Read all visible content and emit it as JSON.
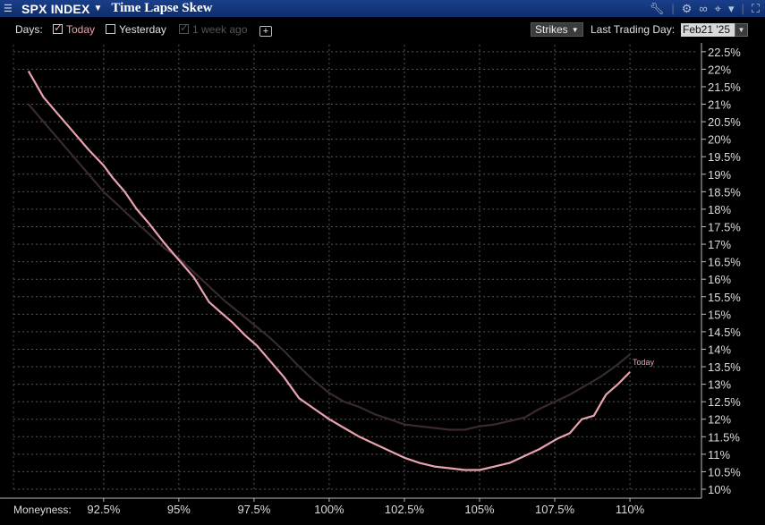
{
  "window": {
    "ticker": "SPX INDEX",
    "title": "Time Lapse Skew"
  },
  "toolbar": {
    "days_label": "Days:",
    "today_label": "Today",
    "yesterday_label": "Yesterday",
    "week_label": "1 week ago",
    "today_checked": true,
    "yesterday_checked": false,
    "week_checked": true,
    "add_label": "+",
    "mode_value": "Strikes",
    "last_trading_label": "Last Trading Day:",
    "last_trading_value": "Feb21 '25"
  },
  "colors": {
    "today": "#e8a3ae",
    "week": "#3a2a2e",
    "grid": "#555555",
    "background": "#000000"
  },
  "chart_data": {
    "type": "line",
    "xlabel": "Moneyness:",
    "ylabel": "",
    "xlim": [
      89.5,
      112.2
    ],
    "ylim": [
      10,
      22.7
    ],
    "x_ticks": [
      "92.5%",
      "95%",
      "97.5%",
      "100%",
      "102.5%",
      "105%",
      "107.5%",
      "110%"
    ],
    "x_tick_values": [
      92.5,
      95,
      97.5,
      100,
      102.5,
      105,
      107.5,
      110
    ],
    "y_ticks": [
      "10%",
      "10.5%",
      "11%",
      "11.5%",
      "12%",
      "12.5%",
      "13%",
      "13.5%",
      "14%",
      "14.5%",
      "15%",
      "15.5%",
      "16%",
      "16.5%",
      "17%",
      "17.5%",
      "18%",
      "18.5%",
      "19%",
      "19.5%",
      "20%",
      "20.5%",
      "21%",
      "21.5%",
      "22%",
      "22.5%"
    ],
    "y_tick_values": [
      10,
      10.5,
      11,
      11.5,
      12,
      12.5,
      13,
      13.5,
      14,
      14.5,
      15,
      15.5,
      16,
      16.5,
      17,
      17.5,
      18,
      18.5,
      19,
      19.5,
      20,
      20.5,
      21,
      21.5,
      22,
      22.5
    ],
    "grid": true,
    "series": [
      {
        "name": "Today",
        "x": [
          90,
          90.5,
          91,
          91.5,
          92,
          92.5,
          92.8,
          93.2,
          93.6,
          94,
          94.5,
          95,
          95.5,
          96,
          96.4,
          96.8,
          97.2,
          97.6,
          98,
          98.5,
          99,
          99.5,
          100,
          100.5,
          101,
          101.5,
          102,
          102.5,
          103,
          103.5,
          104,
          104.5,
          105,
          105.5,
          106,
          106.5,
          107,
          107.3,
          107.6,
          108,
          108.4,
          108.8,
          109.2,
          109.6,
          110
        ],
        "y": [
          21.95,
          21.2,
          20.7,
          20.2,
          19.7,
          19.25,
          18.9,
          18.5,
          18.0,
          17.6,
          17.05,
          16.55,
          16.05,
          15.35,
          15.05,
          14.75,
          14.4,
          14.1,
          13.7,
          13.2,
          12.6,
          12.3,
          12.0,
          11.75,
          11.5,
          11.3,
          11.1,
          10.9,
          10.75,
          10.65,
          10.6,
          10.55,
          10.55,
          10.65,
          10.75,
          10.95,
          11.15,
          11.3,
          11.45,
          11.6,
          12.0,
          12.1,
          12.7,
          13.0,
          13.35
        ]
      },
      {
        "name": "1 week ago",
        "x": [
          90,
          90.5,
          91,
          91.5,
          92,
          92.5,
          93,
          93.5,
          94,
          94.5,
          95,
          95.5,
          96,
          96.5,
          97,
          97.5,
          98,
          98.5,
          99,
          99.5,
          100,
          100.5,
          101,
          101.5,
          102,
          102.5,
          103,
          103.5,
          104,
          104.5,
          105,
          105.5,
          106,
          106.5,
          107,
          107.5,
          108,
          108.5,
          109,
          109.5,
          110
        ],
        "y": [
          21.0,
          20.5,
          20.0,
          19.5,
          19.0,
          18.5,
          18.1,
          17.7,
          17.3,
          16.9,
          16.6,
          16.2,
          15.8,
          15.4,
          15.05,
          14.7,
          14.35,
          13.95,
          13.5,
          13.1,
          12.75,
          12.5,
          12.35,
          12.15,
          12.0,
          11.85,
          11.8,
          11.75,
          11.7,
          11.7,
          11.8,
          11.85,
          11.95,
          12.05,
          12.3,
          12.5,
          12.7,
          12.95,
          13.2,
          13.5,
          13.85
        ]
      }
    ],
    "series_label": "Today"
  }
}
